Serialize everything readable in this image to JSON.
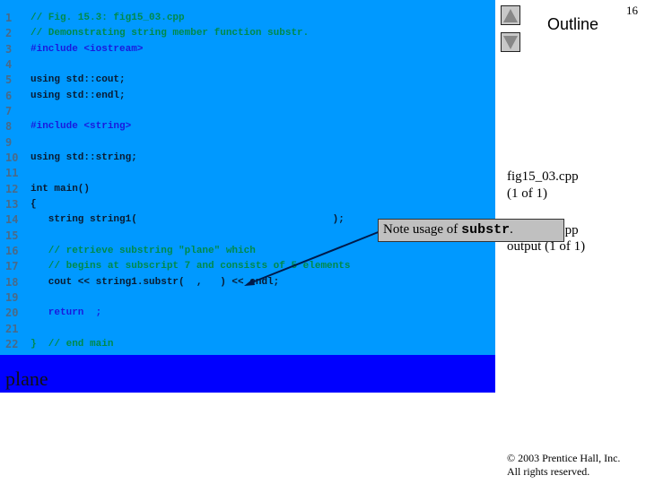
{
  "code_lines": [
    {
      "n": "1",
      "t": "// Fig. 15.3: fig15_03.cpp",
      "c": "cm"
    },
    {
      "n": "2",
      "t": "// Demonstrating string member function substr.",
      "c": "cm"
    },
    {
      "n": "3",
      "t": "#include <iostream>",
      "c": "kw"
    },
    {
      "n": "4",
      "t": "",
      "c": "tx"
    },
    {
      "n": "5",
      "t": "using std::cout;",
      "c": "tx"
    },
    {
      "n": "6",
      "t": "using std::endl;",
      "c": "tx"
    },
    {
      "n": "7",
      "t": "",
      "c": "tx"
    },
    {
      "n": "8",
      "t": "#include <string>",
      "c": "kw"
    },
    {
      "n": "9",
      "t": "",
      "c": "tx"
    },
    {
      "n": "10",
      "t": "using std::string;",
      "c": "tx"
    },
    {
      "n": "11",
      "t": "",
      "c": "tx"
    },
    {
      "n": "12",
      "t": "int main()",
      "c": "tx"
    },
    {
      "n": "13",
      "t": "{",
      "c": "tx"
    },
    {
      "n": "14",
      "t": "   string string1(                                 );",
      "c": "tx"
    },
    {
      "n": "15",
      "t": "",
      "c": "tx"
    },
    {
      "n": "16",
      "t": "   // retrieve substring \"plane\" which",
      "c": "cm"
    },
    {
      "n": "17",
      "t": "   // begins at subscript 7 and consists of 5 elements",
      "c": "cm"
    },
    {
      "n": "18",
      "t": "   cout << string1.substr(  ,   ) << endl;",
      "c": "tx"
    },
    {
      "n": "19",
      "t": "",
      "c": "tx"
    },
    {
      "n": "20",
      "t": "   return  ;",
      "c": "kw"
    },
    {
      "n": "21",
      "t": "",
      "c": "tx"
    },
    {
      "n": "22",
      "t": "}  // end main",
      "c": "cm"
    }
  ],
  "output": "plane",
  "outline": "Outline",
  "page_number": "16",
  "side_labels": [
    "fig15_03.cpp",
    "(1 of 1)",
    "fig15_03.cpp",
    "output (1 of 1)"
  ],
  "note": {
    "prefix": "Note usage of ",
    "code": "substr",
    "suffix": "."
  },
  "footer": {
    "copyright": "© 2003 Prentice Hall, Inc.",
    "rights": "All rights reserved."
  },
  "colors": {
    "code_bg": "#0099ff",
    "output_bg": "#0000ff"
  }
}
